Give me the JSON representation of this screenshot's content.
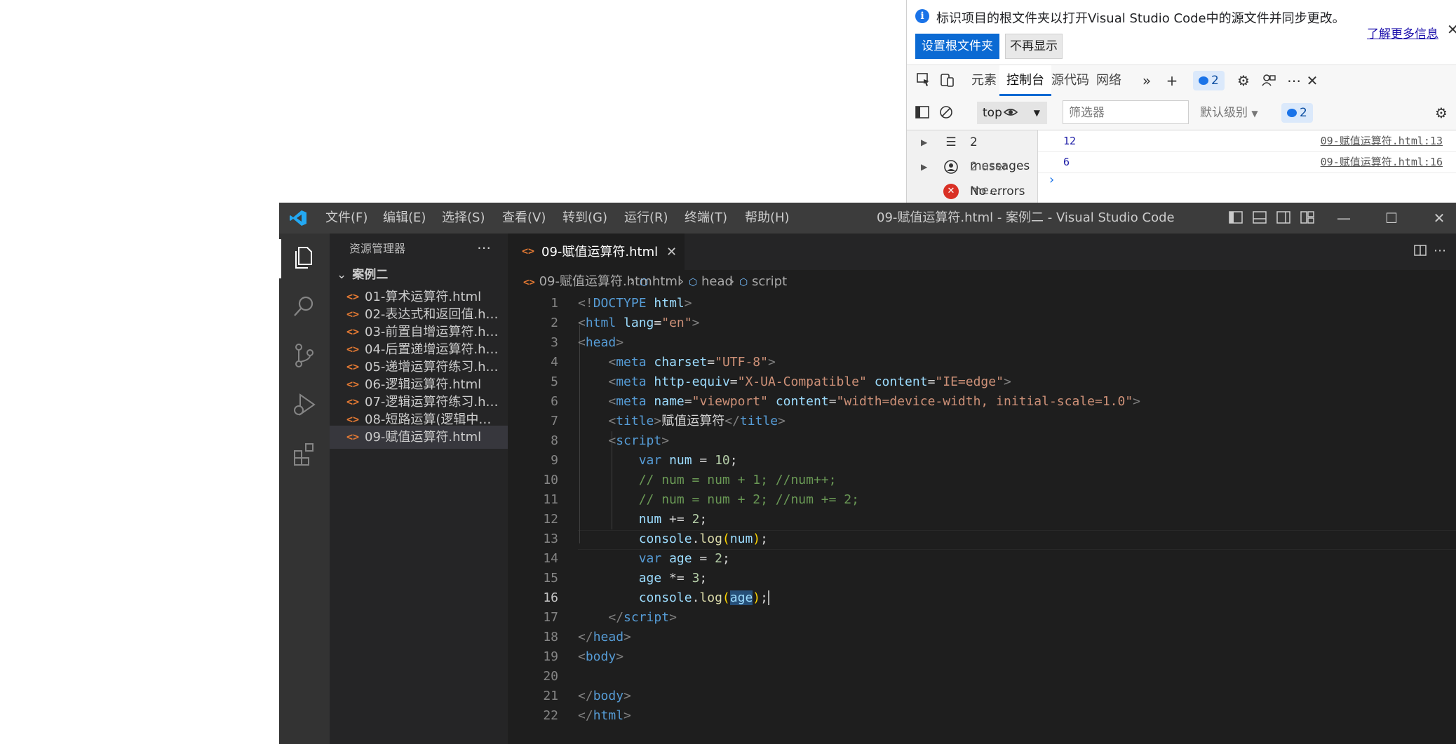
{
  "devtools": {
    "info_text": "标识项目的根文件夹以打开Visual Studio Code中的源文件并同步更改。",
    "learn_more": "了解更多信息",
    "set_root_button": "设置根文件夹",
    "dont_show_button": "不再显示",
    "tabs": [
      "元素",
      "控制台",
      "源代码",
      "网络"
    ],
    "active_tab": "控制台",
    "issues_count": "2",
    "context": "top",
    "filter_placeholder": "筛选器",
    "level": "默认级别",
    "filter_issues_count": "2",
    "sidebar": [
      {
        "label": "2 messages",
        "icon": "list-icon"
      },
      {
        "label": "2 user me...",
        "icon": "user-icon"
      },
      {
        "label": "No errors",
        "icon": "error-icon"
      }
    ],
    "logs": [
      {
        "value": "12",
        "source": "09-赋值运算符.html:13"
      },
      {
        "value": "6",
        "source": "09-赋值运算符.html:16"
      }
    ],
    "prompt": "›"
  },
  "vscode": {
    "title": "09-赋值运算符.html - 案例二 - Visual Studio Code",
    "menu": [
      "文件(F)",
      "编辑(E)",
      "选择(S)",
      "查看(V)",
      "转到(G)",
      "运行(R)",
      "终端(T)",
      "帮助(H)"
    ],
    "explorer_title": "资源管理器",
    "folder": "案例二",
    "files": [
      "01-算术运算符.html",
      "02-表达式和返回值.html",
      "03-前置自增运算符.html",
      "04-后置递增运算符.html",
      "05-递增运算符练习.html",
      "06-逻辑运算符.html",
      "07-逻辑运算符练习.html",
      "08-短路运算(逻辑中断).html",
      "09-赋值运算符.html"
    ],
    "active_file_index": 8,
    "tab_label": "09-赋值运算符.html",
    "breadcrumb": [
      "09-赋值运算符.html",
      "html",
      "head",
      "script"
    ],
    "current_line": 16,
    "line_numbers": [
      "1",
      "2",
      "3",
      "4",
      "5",
      "6",
      "7",
      "8",
      "9",
      "10",
      "11",
      "12",
      "13",
      "14",
      "15",
      "16",
      "17",
      "18",
      "19",
      "20",
      "21",
      "22"
    ]
  },
  "colors": {
    "accent": "#0b6ad3",
    "editor_bg": "#1e1e1e",
    "file_icon": "#e37933"
  }
}
